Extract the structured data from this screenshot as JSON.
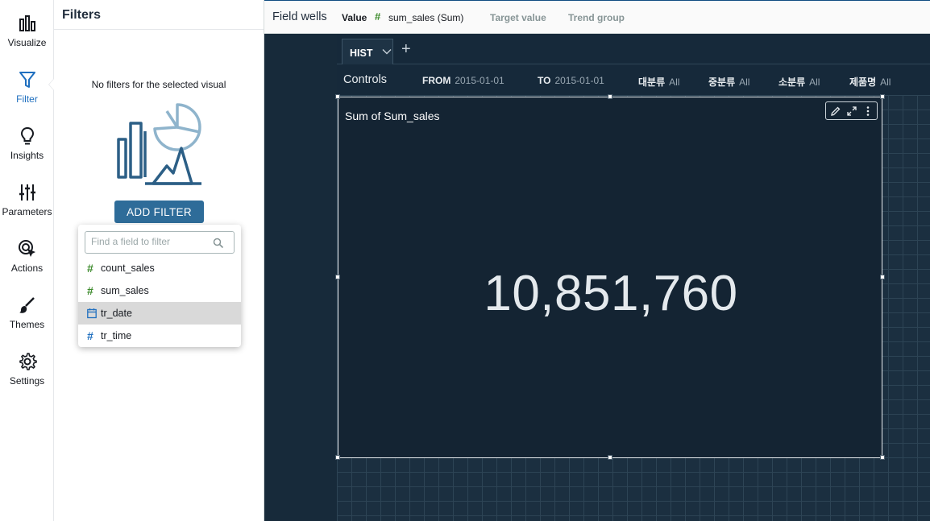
{
  "rail": {
    "items": [
      {
        "label": "Visualize",
        "icon": "bar-chart-icon"
      },
      {
        "label": "Filter",
        "icon": "funnel-icon"
      },
      {
        "label": "Insights",
        "icon": "lightbulb-icon"
      },
      {
        "label": "Parameters",
        "icon": "sliders-icon"
      },
      {
        "label": "Actions",
        "icon": "cursor-target-icon"
      },
      {
        "label": "Themes",
        "icon": "paintbrush-icon"
      },
      {
        "label": "Settings",
        "icon": "gear-icon"
      }
    ],
    "active": "Filter"
  },
  "filters": {
    "title": "Filters",
    "empty_message": "No filters for the selected visual",
    "add_button": "ADD FILTER",
    "dropdown": {
      "placeholder": "Find a field to filter",
      "fields": [
        {
          "name": "count_sales",
          "type": "number"
        },
        {
          "name": "sum_sales",
          "type": "number"
        },
        {
          "name": "tr_date",
          "type": "date"
        },
        {
          "name": "tr_time",
          "type": "number"
        }
      ],
      "highlighted": "tr_date"
    }
  },
  "wells": {
    "title": "Field wells",
    "value_label": "Value",
    "value_field": "sum_sales (Sum)",
    "target_label": "Target value",
    "trend_label": "Trend group"
  },
  "sheet": {
    "tab_label": "HIST",
    "add_label": "+"
  },
  "controls": {
    "title": "Controls",
    "items": [
      {
        "label": "FROM",
        "value": "2015-01-01"
      },
      {
        "label": "TO",
        "value": "2015-01-01"
      },
      {
        "label": "대분류",
        "value": "All"
      },
      {
        "label": "중분류",
        "value": "All"
      },
      {
        "label": "소분류",
        "value": "All"
      },
      {
        "label": "제품명",
        "value": "All"
      }
    ]
  },
  "visual": {
    "title": "Sum of Sum_sales",
    "kpi_value": "10,851,760"
  },
  "colors": {
    "accent": "#2e6c99",
    "canvas": "#172a3a",
    "number_field": "#3b8a2a",
    "date_field": "#1f6fbf"
  }
}
